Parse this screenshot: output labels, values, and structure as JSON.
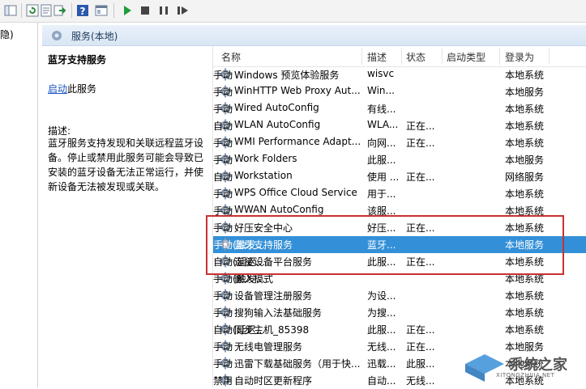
{
  "tree": {
    "item": "隐)"
  },
  "header": {
    "title": "服务(本地)"
  },
  "details": {
    "service_name": "蓝牙支持服务",
    "action_link": "启动",
    "action_suffix": "此服务",
    "desc_label": "描述:",
    "desc_text": "蓝牙服务支持发现和关联远程蓝牙设备。停止或禁用此服务可能会导致已安装的蓝牙设备无法正常运行，并使新设备无法被发现或关联。"
  },
  "columns": {
    "name": "名称",
    "desc": "描述",
    "status": "状态",
    "startup": "启动类型",
    "logon": "登录为"
  },
  "rows": [
    {
      "name": "Windows 预览体验服务",
      "desc": "wisvc",
      "status": "",
      "startup": "手动",
      "logon": "本地系统"
    },
    {
      "name": "WinHTTP Web Proxy Aut...",
      "desc": "Win...",
      "status": "",
      "startup": "手动",
      "logon": "本地服务"
    },
    {
      "name": "Wired AutoConfig",
      "desc": "有线...",
      "status": "",
      "startup": "手动",
      "logon": "本地系统"
    },
    {
      "name": "WLAN AutoConfig",
      "desc": "WLA...",
      "status": "正在...",
      "startup": "自动",
      "logon": "本地系统"
    },
    {
      "name": "WMI Performance Adapt...",
      "desc": "向网...",
      "status": "正在...",
      "startup": "手动",
      "logon": "本地系统"
    },
    {
      "name": "Work Folders",
      "desc": "此服...",
      "status": "",
      "startup": "手动",
      "logon": "本地服务"
    },
    {
      "name": "Workstation",
      "desc": "使用 ...",
      "status": "正在...",
      "startup": "自动",
      "logon": "网络服务"
    },
    {
      "name": "WPS Office Cloud Service",
      "desc": "用于...",
      "status": "",
      "startup": "手动",
      "logon": "本地系统"
    },
    {
      "name": "WWAN AutoConfig",
      "desc": "该服...",
      "status": "",
      "startup": "手动",
      "logon": "本地系统"
    },
    {
      "name": "好压安全中心",
      "desc": "好压...",
      "status": "正在...",
      "startup": "手动",
      "logon": "本地系统"
    },
    {
      "name": "蓝牙支持服务",
      "desc": "蓝牙...",
      "status": "",
      "startup": "手动(触发...",
      "logon": "本地服务"
    },
    {
      "name": "连接设备平台服务",
      "desc": "此服...",
      "status": "正在...",
      "startup": "自动(延迟...",
      "logon": "本地系统"
    },
    {
      "name": "嵌入模式",
      "desc": "",
      "status": "",
      "startup": "手动(触发...",
      "logon": "本地系统"
    },
    {
      "name": "设备管理注册服务",
      "desc": "为设...",
      "status": "",
      "startup": "手动",
      "logon": "本地系统"
    },
    {
      "name": "搜狗输入法基础服务",
      "desc": "为搜...",
      "status": "",
      "startup": "手动",
      "logon": "本地系统"
    },
    {
      "name": "同步主机_85398",
      "desc": "此服...",
      "status": "正在...",
      "startup": "自动(延迟...",
      "logon": "本地系统"
    },
    {
      "name": "无线电管理服务",
      "desc": "无线...",
      "status": "正在...",
      "startup": "手动",
      "logon": "本地服务"
    },
    {
      "name": "迅雷下载基础服务（用于快...",
      "desc": "迅载...",
      "status": "此服...",
      "startup": "手动",
      "logon": "本地系统"
    },
    {
      "name": "自动时区更新程序",
      "desc": "自动...",
      "status": "无线...",
      "startup": "禁用",
      "logon": "本地系统"
    }
  ],
  "watermark": {
    "text": "系统之家",
    "url": "XITONGZHIJIA.NET"
  },
  "colors": {
    "selection": "#3390d8",
    "highlight_box": "#c83232",
    "link": "#1a55c6"
  }
}
